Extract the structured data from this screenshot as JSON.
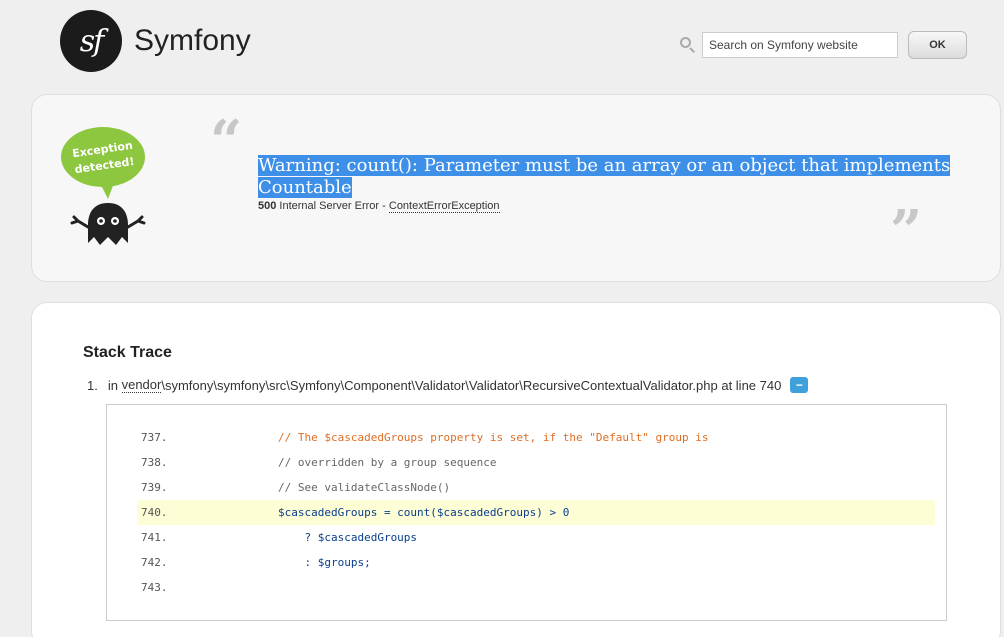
{
  "header": {
    "logo_mark": "sf",
    "logo_text": "Symfony",
    "search_placeholder": "Search on Symfony website",
    "ok_label": "OK"
  },
  "exception": {
    "badge_line1": "Exception",
    "badge_line2": "detected!",
    "quote_open": "“",
    "quote_close": "”",
    "message": "Warning: count(): Parameter must be an array or an object that implements Countable",
    "status_code": "500",
    "status_text": "Internal Server Error",
    "status_sep": "-",
    "class_name": "ContextErrorException"
  },
  "trace": {
    "title": "Stack Trace",
    "item_number": "1.",
    "item_in": "in",
    "item_vendor": "vendor",
    "item_path": "\\symfony\\symfony\\src\\Symfony\\Component\\Validator\\Validator\\RecursiveContextualValidator.php",
    "item_at": "at line 740",
    "toggle_label": "−",
    "code": [
      {
        "line": "737.",
        "text": "        // The $cascadedGroups property is set, if the \"Default\" group is",
        "style": "orange"
      },
      {
        "line": "738.",
        "text": "        // overridden by a group sequence",
        "style": "gray"
      },
      {
        "line": "739.",
        "text": "        // See validateClassNode()",
        "style": "gray"
      },
      {
        "line": "740.",
        "text": "        $cascadedGroups = count($cascadedGroups) > 0",
        "style": "blue"
      },
      {
        "line": "741.",
        "text": "            ? $cascadedGroups",
        "style": "blue"
      },
      {
        "line": "742.",
        "text": "            : $groups;",
        "style": "blue"
      },
      {
        "line": "743.",
        "text": "",
        "style": "blue"
      }
    ],
    "highlight_line": "740."
  },
  "colors": {
    "selection": "#3d8fe8",
    "toggle": "#3ea1dc",
    "highlight_row": "#fdfdd6",
    "badge_green": "#8dc63f"
  }
}
